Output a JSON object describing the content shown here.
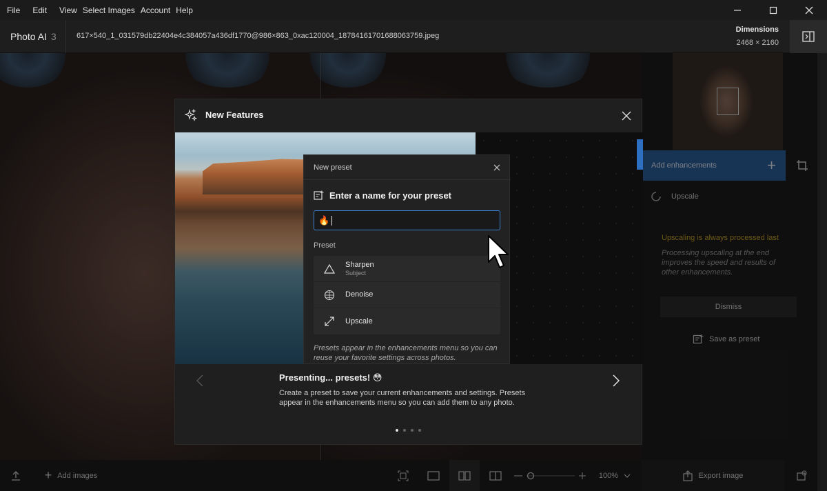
{
  "menu": {
    "items": [
      "File",
      "Edit",
      "View",
      "Select Images",
      "Account",
      "Help"
    ]
  },
  "titlebar": {
    "app_name": "Photo AI",
    "app_version": "3",
    "filename": "617×540_1_031579db22404e4c384057a436df1770@986×863_0xac120004_18784161701688063759.jpeg",
    "dimensions_label": "Dimensions",
    "dimensions_value": "2468 × 2160"
  },
  "sidebar": {
    "add_enhancements": "Add enhancements",
    "upscale_label": "Upscale",
    "note_title": "Upscaling is always processed last",
    "note_body": "Processing upscaling at the end improves the speed and results of other enhancements.",
    "dismiss": "Dismiss",
    "save_as_preset": "Save as preset"
  },
  "bottombar": {
    "add_images": "Add images",
    "zoom": "100%",
    "export": "Export image"
  },
  "modal": {
    "title": "New Features",
    "preset_dialog": {
      "title": "New preset",
      "heading": "Enter a name for your preset",
      "input_value": "🔥",
      "preset_label": "Preset",
      "items": [
        {
          "name": "Sharpen",
          "sub": "Subject",
          "icon": "triangle-icon"
        },
        {
          "name": "Denoise",
          "sub": "",
          "icon": "grain-icon"
        },
        {
          "name": "Upscale",
          "sub": "",
          "icon": "expand-arrows-icon"
        }
      ],
      "hint": "Presets appear in the enhancements menu so you can reuse your favorite settings across photos."
    },
    "caption_title": "Presenting... presets! 😳",
    "caption_text": "Create a preset to save your current enhancements and settings. Presets appear in the enhancements menu so you can add them to any photo.",
    "page_index": 1,
    "page_count": 4
  },
  "colors": {
    "accent_blue": "#2d5f9a",
    "input_focus": "#3b82d6",
    "warning": "#c9a227"
  }
}
